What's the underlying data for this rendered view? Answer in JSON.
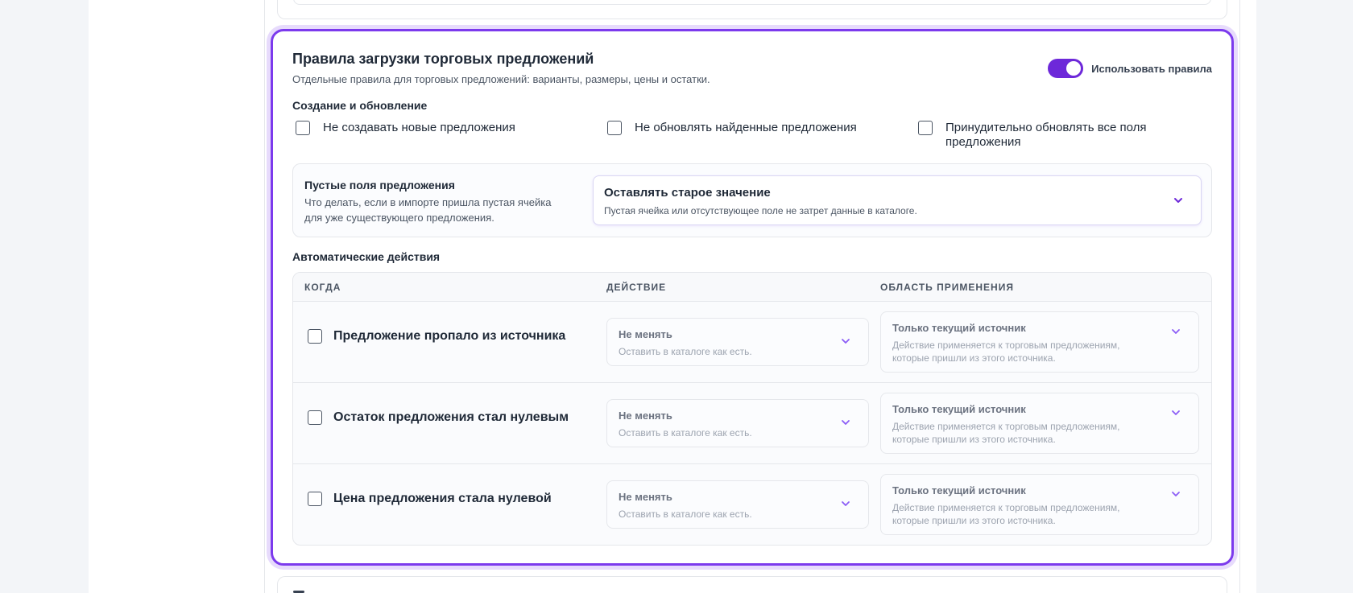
{
  "rules": {
    "title": "Правила загрузки торговых предложений",
    "subtitle": "Отдельные правила для торговых предложений: варианты, размеры, цены и остатки.",
    "toggle_label": "Использовать правила",
    "toggle_on": true,
    "accent_color": "#7c3aed"
  },
  "create_update": {
    "label": "Создание и обновление",
    "options": [
      {
        "label": "Не создавать новые предложения",
        "checked": false
      },
      {
        "label": "Не обновлять найденные предложения",
        "checked": false
      },
      {
        "label": "Принудительно обновлять все поля предложения",
        "checked": false
      }
    ]
  },
  "empty_fields": {
    "title": "Пустые поля предложения",
    "description": "Что делать, если в импорте пришла пустая ячейка для уже существующего предложения.",
    "selected_title": "Оставлять старое значение",
    "selected_description": "Пустая ячейка или отсутствующее поле не затрет данные в каталоге."
  },
  "auto_actions": {
    "label": "Автоматические действия",
    "columns": [
      "КОГДА",
      "ДЕЙСТВИЕ",
      "ОБЛАСТЬ ПРИМЕНЕНИЯ"
    ],
    "rows": [
      {
        "when": "Предложение пропало из источника",
        "action_title": "Не менять",
        "action_desc": "Оставить в каталоге как есть.",
        "scope_title": "Только текущий источник",
        "scope_desc": "Действие применяется к торговым предложениям, которые пришли из этого источника."
      },
      {
        "when": "Остаток предложения стал нулевым",
        "action_title": "Не менять",
        "action_desc": "Оставить в каталоге как есть.",
        "scope_title": "Только текущий источник",
        "scope_desc": "Действие применяется к торговым предложениям, которые пришли из этого источника."
      },
      {
        "when": "Цена предложения стала нулевой",
        "action_title": "Не менять",
        "action_desc": "Оставить в каталоге как есть.",
        "scope_title": "Только текущий источник",
        "scope_desc": "Действие применяется к торговым предложениям, которые пришли из этого источника."
      }
    ]
  },
  "icons": {
    "dropdown": "chevron-down-icon",
    "checkbox": "checkbox-icon"
  }
}
